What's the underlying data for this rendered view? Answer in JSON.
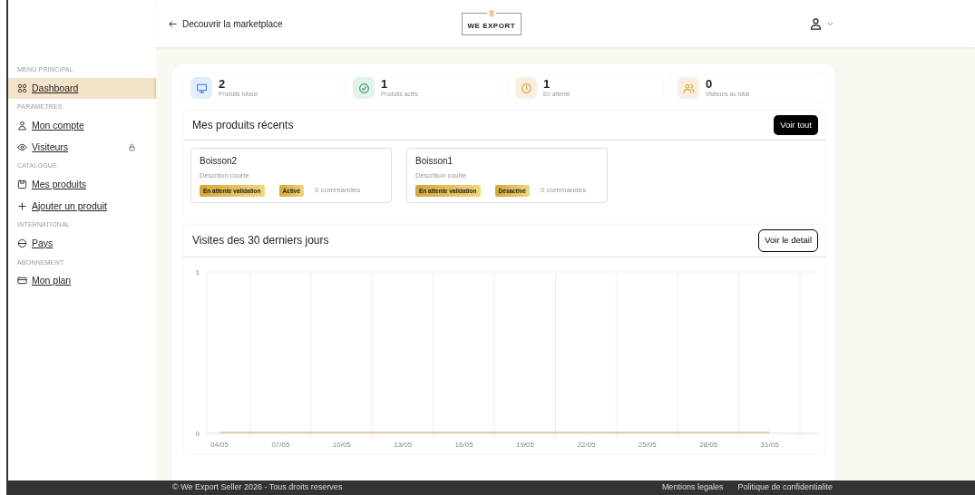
{
  "header": {
    "back_link": "Decouvrir la marketplace",
    "logo": "WE EXPORT"
  },
  "sidebar": {
    "sections": [
      {
        "heading": "MENU PRINCIPAL",
        "items": [
          {
            "label": "Dashboard",
            "kind": "grid",
            "selected": true,
            "locked": false
          }
        ]
      },
      {
        "heading": "PARAMETRES",
        "items": [
          {
            "label": "Mon compte",
            "kind": "user",
            "selected": false,
            "locked": false
          },
          {
            "label": "Visiteurs",
            "kind": "eye",
            "selected": false,
            "locked": true
          }
        ]
      },
      {
        "heading": "CATALOGUE",
        "items": [
          {
            "label": "Mes produits",
            "kind": "box",
            "selected": false,
            "locked": false
          },
          {
            "label": "Ajouter un produit",
            "kind": "plus",
            "selected": false,
            "locked": false
          }
        ]
      },
      {
        "heading": "INTERNATIONAL",
        "items": [
          {
            "label": "Pays",
            "kind": "globe",
            "selected": false,
            "locked": false
          }
        ]
      },
      {
        "heading": "ABONNEMENT",
        "items": [
          {
            "label": "Mon plan",
            "kind": "card",
            "selected": false,
            "locked": false
          }
        ]
      }
    ]
  },
  "stats": [
    {
      "value": "2",
      "label": "Produits totaux",
      "kind": "monitor",
      "color": "#e3eefc"
    },
    {
      "value": "1",
      "label": "Produits actifs",
      "kind": "check",
      "color": "#e3f2ea"
    },
    {
      "value": "1",
      "label": "En attente",
      "kind": "clock",
      "color": "#f8efe0"
    },
    {
      "value": "0",
      "label": "Visiteurs au total",
      "kind": "users",
      "color": "#f8efe0"
    }
  ],
  "recent_products": {
    "title": "Mes produits récents",
    "button": "Voir tout",
    "products": [
      {
        "name": "Boisson2",
        "description": "Descrtion courte",
        "status": "En attente validation",
        "activation": "Activé",
        "orders": "0 commandes"
      },
      {
        "name": "Boisson1",
        "description": "Descrition courte",
        "status": "En attente validation",
        "activation": "Désactivé",
        "orders": "0 commandes"
      }
    ]
  },
  "visits": {
    "title": "Visites des 30 derniers jours",
    "button": "Voir le detail",
    "chart_data": {
      "type": "line",
      "categories": [
        "04/05",
        "07/05",
        "10/05",
        "13/05",
        "16/05",
        "19/05",
        "22/05",
        "25/05",
        "28/05",
        "31/05"
      ],
      "ylim": [
        0,
        1
      ],
      "yticks": [
        0,
        1
      ],
      "values": [
        0,
        0,
        0,
        0,
        0,
        0,
        0,
        0,
        0,
        0
      ]
    }
  },
  "footer": {
    "copyright": "© We Export Seller 2026 - Tous droits reserves",
    "links": [
      "Mentions legales",
      "Politique de confidentialite"
    ]
  }
}
